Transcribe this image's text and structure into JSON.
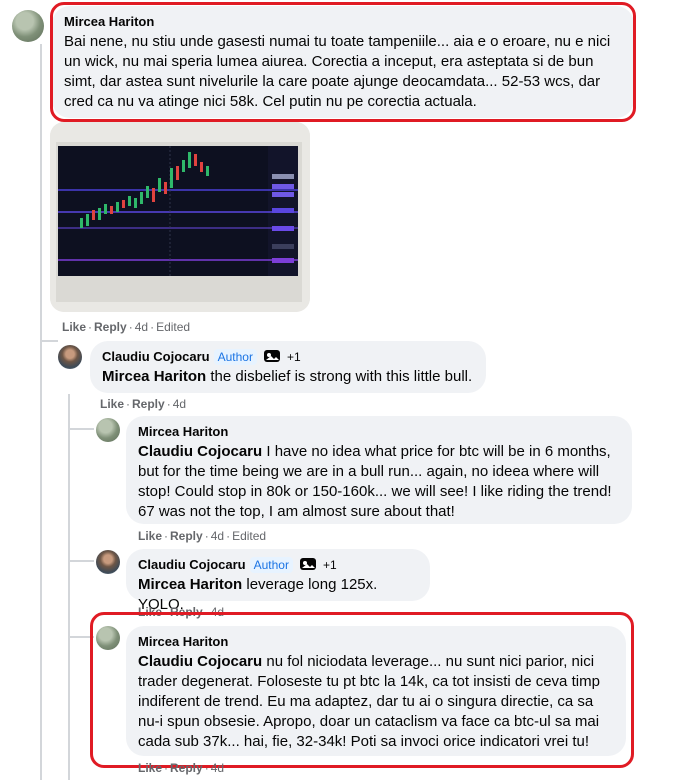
{
  "comments": [
    {
      "author": "Mircea Hariton",
      "text": "Bai nene, nu stiu unde gasesti numai tu toate tampeniile... aia e o eroare, nu e nici un wick, nu mai speria lumea aiurea. Corectia a inceput, era asteptata si de bun simt, dar astea sunt nivelurile la care poate ajunge deocamdata... 52-53 wcs, dar cred ca nu va atinge nici 58k. Cel putin nu pe corectia actuala.",
      "actions": {
        "like": "Like",
        "reply": "Reply",
        "time": "4d",
        "edited": "Edited"
      }
    },
    {
      "author": "Claudiu Cojocaru",
      "badge": "Author",
      "plus": "+1",
      "mention": "Mircea Hariton",
      "text": " the disbelief is strong with this little bull.",
      "actions": {
        "like": "Like",
        "reply": "Reply",
        "time": "4d"
      }
    },
    {
      "author": "Mircea Hariton",
      "mention": "Claudiu Cojocaru",
      "text": " I have no idea what price for btc will be in 6 months, but for the time being we are in a bull run... again, no ideea where will stop! Could stop in 80k or 150-160k... we will see! I like riding the trend! 67 was not the top, I am almost sure about that!",
      "actions": {
        "like": "Like",
        "reply": "Reply",
        "time": "4d",
        "edited": "Edited"
      }
    },
    {
      "author": "Claudiu Cojocaru",
      "badge": "Author",
      "plus": "+1",
      "mention": "Mircea Hariton",
      "text": " leverage long 125x. YOLO.",
      "actions": {
        "like": "Like",
        "reply": "Reply",
        "time": "4d"
      }
    },
    {
      "author": "Mircea Hariton",
      "mention": "Claudiu Cojocaru",
      "text": " nu fol niciodata leverage... nu sunt nici parior, nici trader degenerat. Foloseste tu pt btc la 14k, ca tot insisti de ceva timp indiferent de trend. Eu ma adaptez, dar tu ai o singura directie, ca sa nu-i spun obsesie. Apropo, doar un cataclism va face ca btc-ul sa mai cada sub 37k... hai, fie, 32-34k! Poti sa invoci orice indicatori vrei tu!",
      "actions": {
        "like": "Like",
        "reply": "Reply",
        "time": "4d"
      }
    }
  ],
  "colors": {
    "highlight": "#e01b24",
    "author_badge": "#1b74e4",
    "bubble": "#f0f2f5"
  }
}
